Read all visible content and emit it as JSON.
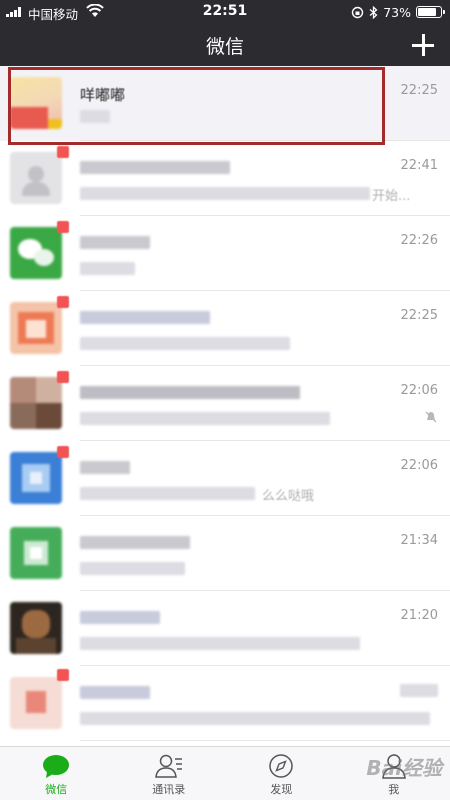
{
  "status_bar": {
    "carrier": "中国移动",
    "time": "22:51",
    "battery_text": "73%",
    "battery_level": 0.73
  },
  "nav": {
    "title": "微信"
  },
  "chats": [
    {
      "name": "咩嘟嘟",
      "time": "22:25",
      "pinned": true
    },
    {
      "name": "",
      "time": "22:41",
      "snippet": "开始..."
    },
    {
      "name": "",
      "time": "22:26"
    },
    {
      "name": "",
      "time": "22:25"
    },
    {
      "name": "",
      "time": "22:06",
      "muted": true
    },
    {
      "name": "",
      "time": "22:06",
      "snippet": "么么哒哦"
    },
    {
      "name": "",
      "time": "21:34"
    },
    {
      "name": "",
      "time": "21:20"
    },
    {
      "name": "",
      "time": ""
    }
  ],
  "tabs": [
    {
      "label": "微信",
      "icon": "chat-bubble-icon",
      "active": true
    },
    {
      "label": "通讯录",
      "icon": "contacts-icon",
      "active": false
    },
    {
      "label": "发现",
      "icon": "compass-icon",
      "active": false
    },
    {
      "label": "我",
      "icon": "person-icon",
      "active": false
    }
  ],
  "watermark": "Bai经验",
  "colors": {
    "header": "#2b2b30",
    "accent": "#1aad19",
    "highlight_box": "#a52a2a"
  }
}
